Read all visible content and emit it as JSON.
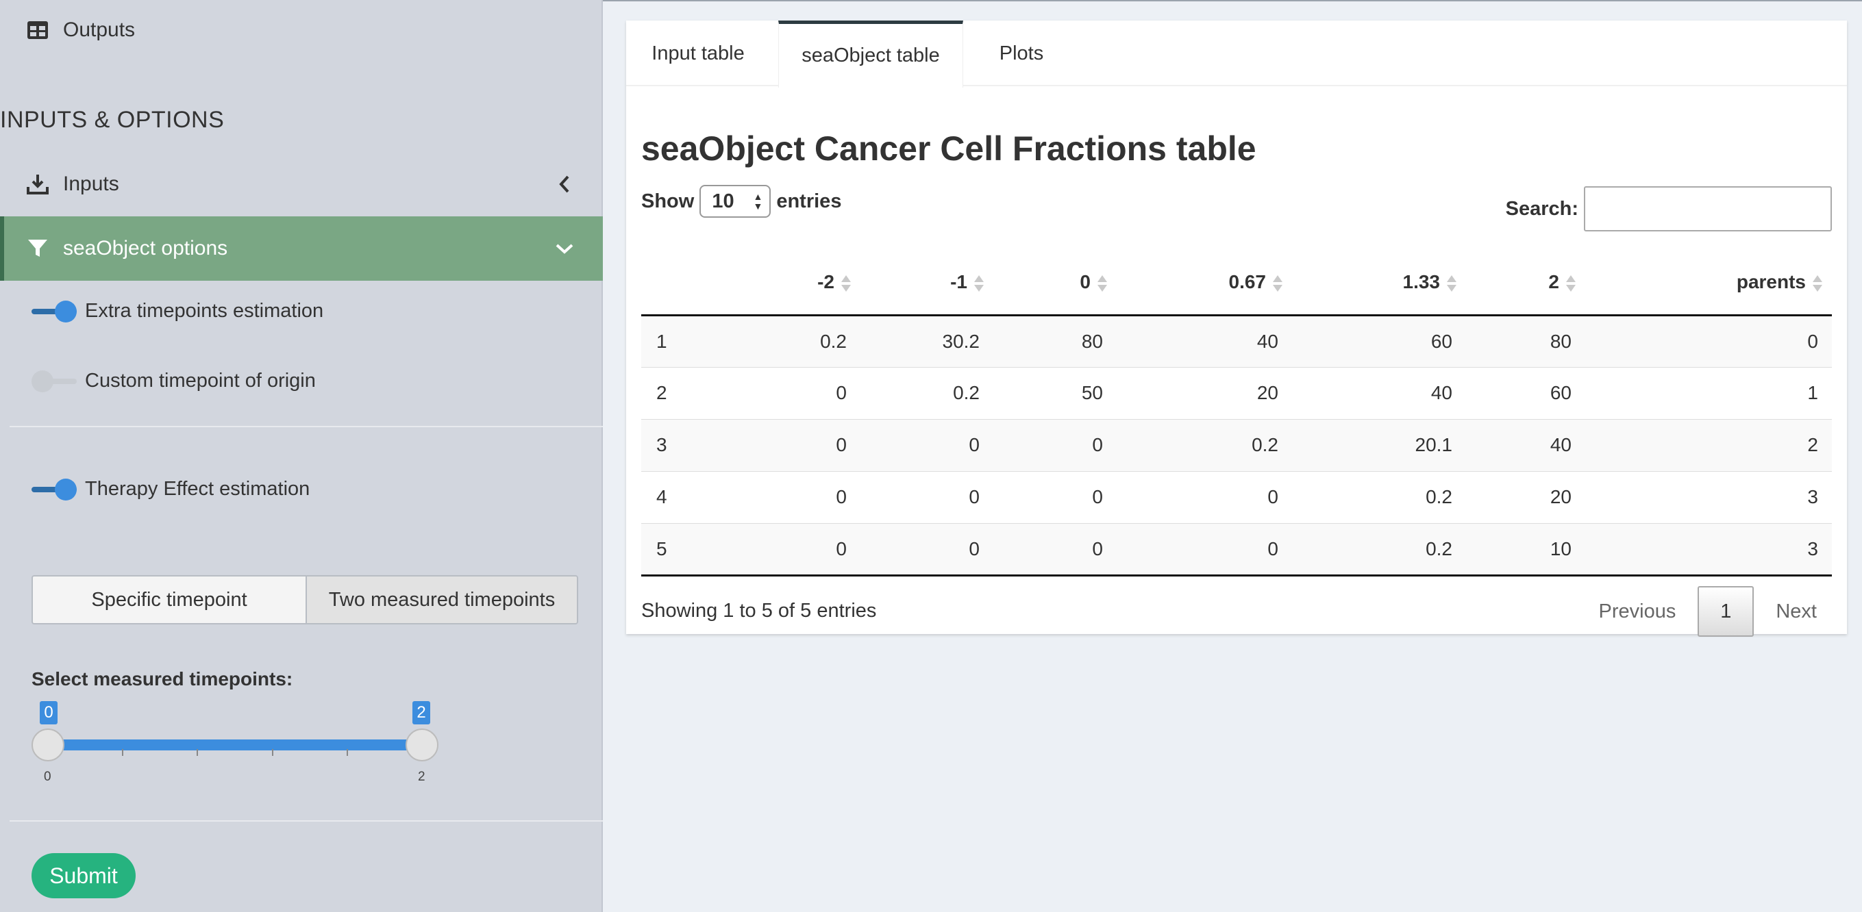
{
  "sidebar": {
    "outputs_label": "Outputs",
    "section_header": "INPUTS & OPTIONS",
    "inputs_label": "Inputs",
    "sea_options_label": "seaObject options",
    "toggles": {
      "extra_timepoints": {
        "label": "Extra timepoints estimation",
        "on": true
      },
      "custom_origin": {
        "label": "Custom timepoint of origin",
        "on": false
      },
      "therapy_effect": {
        "label": "Therapy Effect estimation",
        "on": true
      }
    },
    "mode_buttons": {
      "specific": "Specific timepoint",
      "two_measured": "Two measured timepoints",
      "selected": "two_measured"
    },
    "slider": {
      "label": "Select measured timepoints:",
      "min": "0",
      "max": "2",
      "low_value": "0",
      "high_value": "2"
    },
    "submit_label": "Submit",
    "accent_color": "#7aa784"
  },
  "main": {
    "tabs": [
      {
        "label": "Input table",
        "active": false
      },
      {
        "label": "seaObject table",
        "active": true
      },
      {
        "label": "Plots",
        "active": false
      }
    ],
    "title": "seaObject Cancer Cell Fractions table",
    "show": {
      "prefix": "Show",
      "value": "10",
      "suffix": "entries"
    },
    "search_label": "Search:",
    "table": {
      "columns": [
        "",
        "-2",
        "-1",
        "0",
        "0.67",
        "1.33",
        "2",
        "parents"
      ],
      "rows": [
        [
          "1",
          "0.2",
          "30.2",
          "80",
          "40",
          "60",
          "80",
          "0"
        ],
        [
          "2",
          "0",
          "0.2",
          "50",
          "20",
          "40",
          "60",
          "1"
        ],
        [
          "3",
          "0",
          "0",
          "0",
          "0.2",
          "20.1",
          "40",
          "2"
        ],
        [
          "4",
          "0",
          "0",
          "0",
          "0",
          "0.2",
          "20",
          "3"
        ],
        [
          "5",
          "0",
          "0",
          "0",
          "0",
          "0.2",
          "10",
          "3"
        ]
      ]
    },
    "info": "Showing 1 to 5 of 5 entries",
    "pager": {
      "previous": "Previous",
      "current": "1",
      "next": "Next"
    }
  }
}
